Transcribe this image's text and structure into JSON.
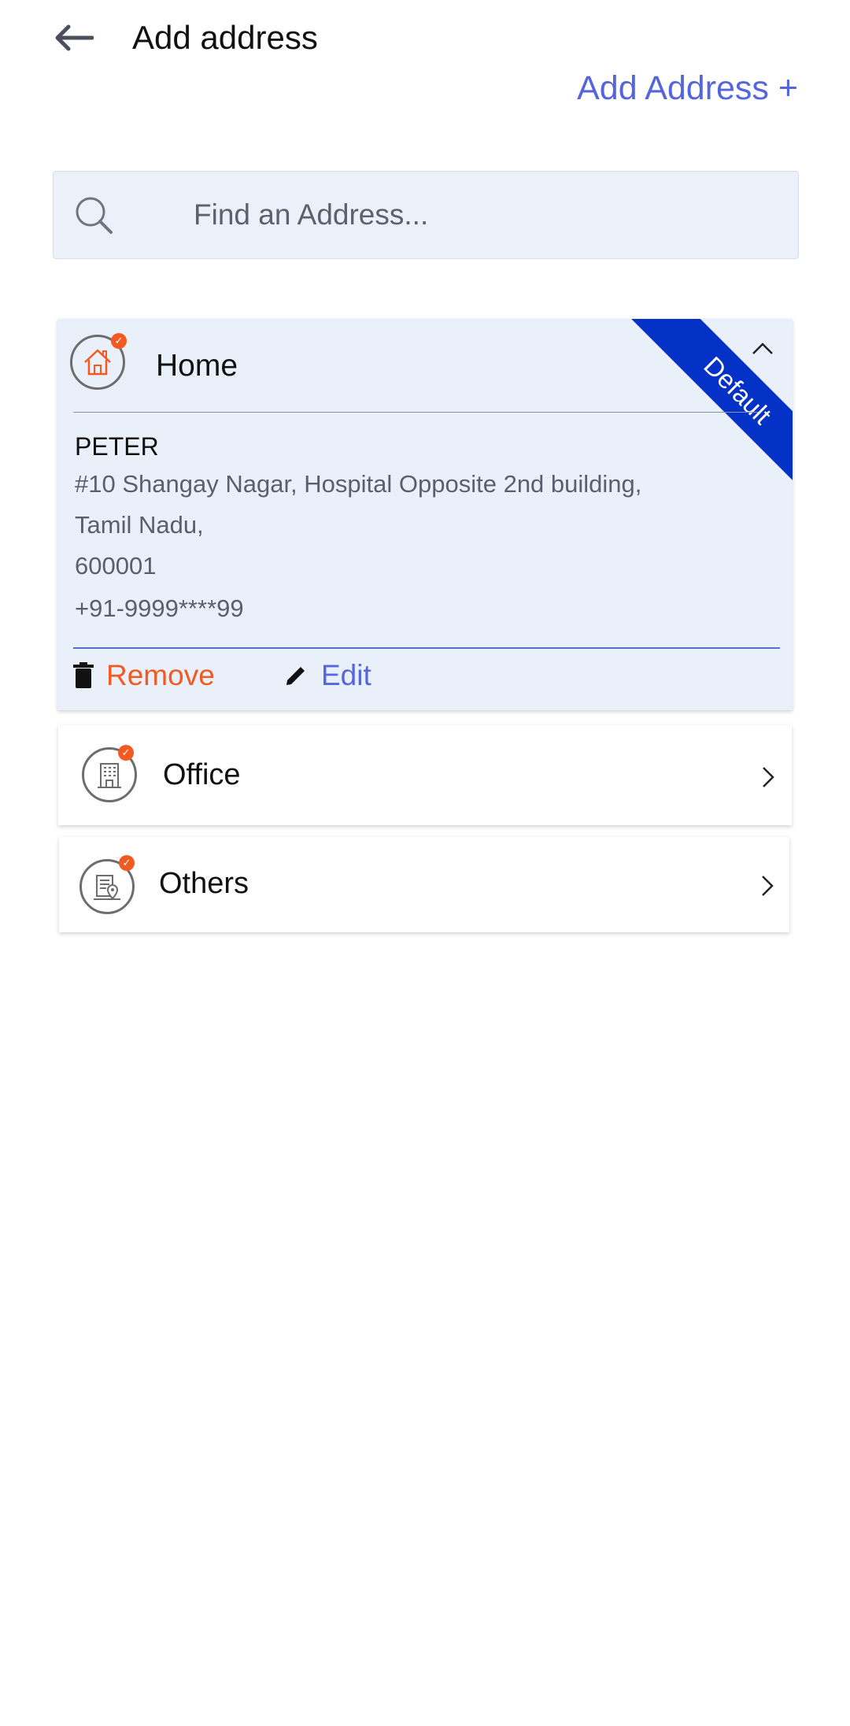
{
  "header": {
    "title": "Add address",
    "add_link": "Add Address +"
  },
  "search": {
    "placeholder": "Find an Address..."
  },
  "addresses": [
    {
      "label": "Home",
      "badge": "Default",
      "name": "PETER",
      "lines": [
        "#10 Shangay Nagar, Hospital Opposite 2nd building,",
        "Tamil Nadu,",
        "600001"
      ],
      "phone": "+91-9999****99",
      "remove_label": "Remove",
      "edit_label": "Edit",
      "expanded": true
    },
    {
      "label": "Office",
      "expanded": false
    },
    {
      "label": "Others",
      "expanded": false
    }
  ],
  "colors": {
    "accent": "#5566dd",
    "danger": "#f25a22",
    "ribbon": "#0532c6",
    "card_bg": "#eaf0f9"
  },
  "icons": [
    "back-arrow-icon",
    "search-icon",
    "home-icon",
    "office-building-icon",
    "others-location-icon",
    "chevron-up-icon",
    "chevron-right-icon",
    "trash-icon",
    "pencil-icon",
    "check-icon"
  ]
}
